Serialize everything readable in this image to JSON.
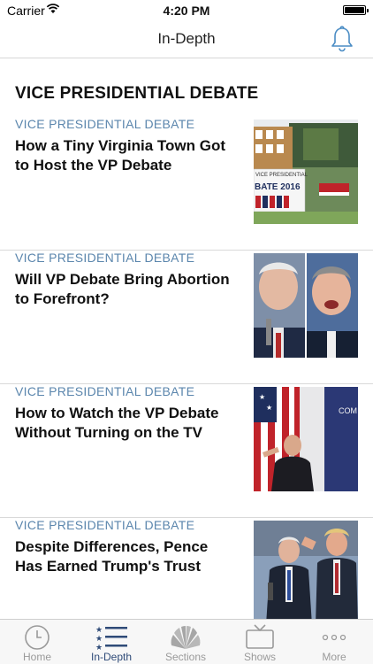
{
  "status_bar": {
    "carrier": "Carrier",
    "time": "4:20 PM"
  },
  "nav": {
    "title": "In-Depth",
    "bell_icon": "bell-icon"
  },
  "section": {
    "heading": "VICE PRESIDENTIAL DEBATE"
  },
  "stories": [
    {
      "kicker": "VICE PRESIDENTIAL DEBATE",
      "headline": "How a Tiny Virginia Town Got to Host the VP Debate",
      "thumb_sign_text": "VICE PRESIDENTIAL",
      "thumb_sign_year": "BATE 2016"
    },
    {
      "kicker": "VICE PRESIDENTIAL DEBATE",
      "headline": "Will VP Debate Bring Abortion to Forefront?"
    },
    {
      "kicker": "VICE PRESIDENTIAL DEBATE",
      "headline": "How to Watch the VP Debate Without Turning on the TV",
      "thumb_banner_text": "COM PRESI DE"
    },
    {
      "kicker": "VICE PRESIDENTIAL DEBATE",
      "headline": "Despite Differences, Pence Has Earned Trump's Trust"
    }
  ],
  "tabs": [
    {
      "label": "Home",
      "icon": "clock-icon",
      "active": false
    },
    {
      "label": "In-Depth",
      "icon": "star-list-icon",
      "active": true
    },
    {
      "label": "Sections",
      "icon": "peacock-icon",
      "active": false
    },
    {
      "label": "Shows",
      "icon": "tv-icon",
      "active": false
    },
    {
      "label": "More",
      "icon": "ellipsis-icon",
      "active": false
    }
  ],
  "colors": {
    "kicker": "#5b86ad",
    "tab_active": "#2f4b78",
    "tab_inactive": "#9a9a9a"
  }
}
